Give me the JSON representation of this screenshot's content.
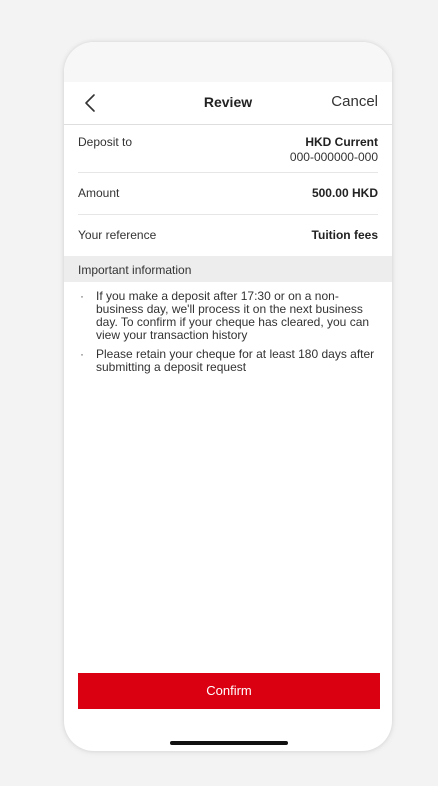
{
  "nav": {
    "title": "Review",
    "cancel_label": "Cancel",
    "back_icon": "chevron-left-icon"
  },
  "details": [
    {
      "label": "Deposit to",
      "value_line1": "HKD Current",
      "value_line2": "000-000000-000"
    },
    {
      "label": "Amount",
      "value_line1": "500.00 HKD"
    },
    {
      "label": "Your reference",
      "value_line1": "Tuition fees"
    }
  ],
  "info": {
    "header": "Important information",
    "items": [
      "If you make a deposit after 17:30 or on a non-business day, we'll process it on the next business day. To confirm if your cheque has cleared, you can view your transaction history",
      "Please retain your cheque for at least 180 days after submitting a deposit request"
    ],
    "bullet": "·"
  },
  "actions": {
    "confirm_label": "Confirm"
  },
  "colors": {
    "accent": "#db0011",
    "background": "#f3f3f3",
    "section_header_bg": "#ededed"
  }
}
